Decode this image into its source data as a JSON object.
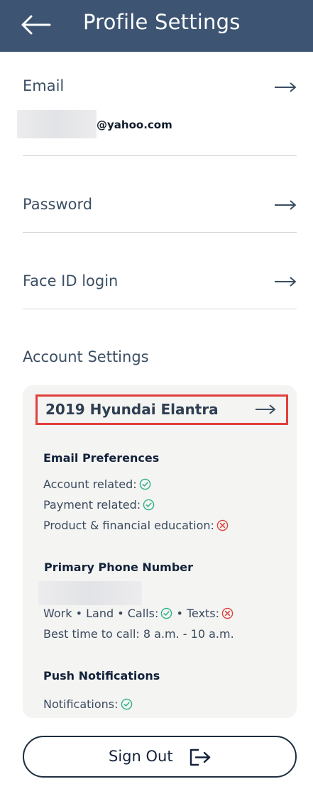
{
  "header": {
    "title": "Profile Settings"
  },
  "email": {
    "label": "Email",
    "domain": "@yahoo.com"
  },
  "password": {
    "label": "Password"
  },
  "faceid": {
    "label": "Face ID login"
  },
  "account": {
    "title": "Account Settings",
    "vehicle": "2019 Hyundai Elantra",
    "email_prefs": {
      "heading": "Email Preferences",
      "account_related": "Account related:",
      "payment_related": "Payment related:",
      "product_education": "Product & financial education:"
    },
    "phone": {
      "heading": "Primary Phone Number",
      "types_label": "Work • Land • Calls:",
      "texts_label": "• Texts:",
      "best_time": "Best time to call: 8 a.m. - 10 a.m."
    },
    "push": {
      "heading": "Push Notifications",
      "notifications": "Notifications:"
    }
  },
  "signout": {
    "label": "Sign Out"
  },
  "colors": {
    "header_bg": "#3d5573",
    "check": "#2eb08a",
    "cross": "#e0403c",
    "highlight_border": "#e0403c"
  }
}
